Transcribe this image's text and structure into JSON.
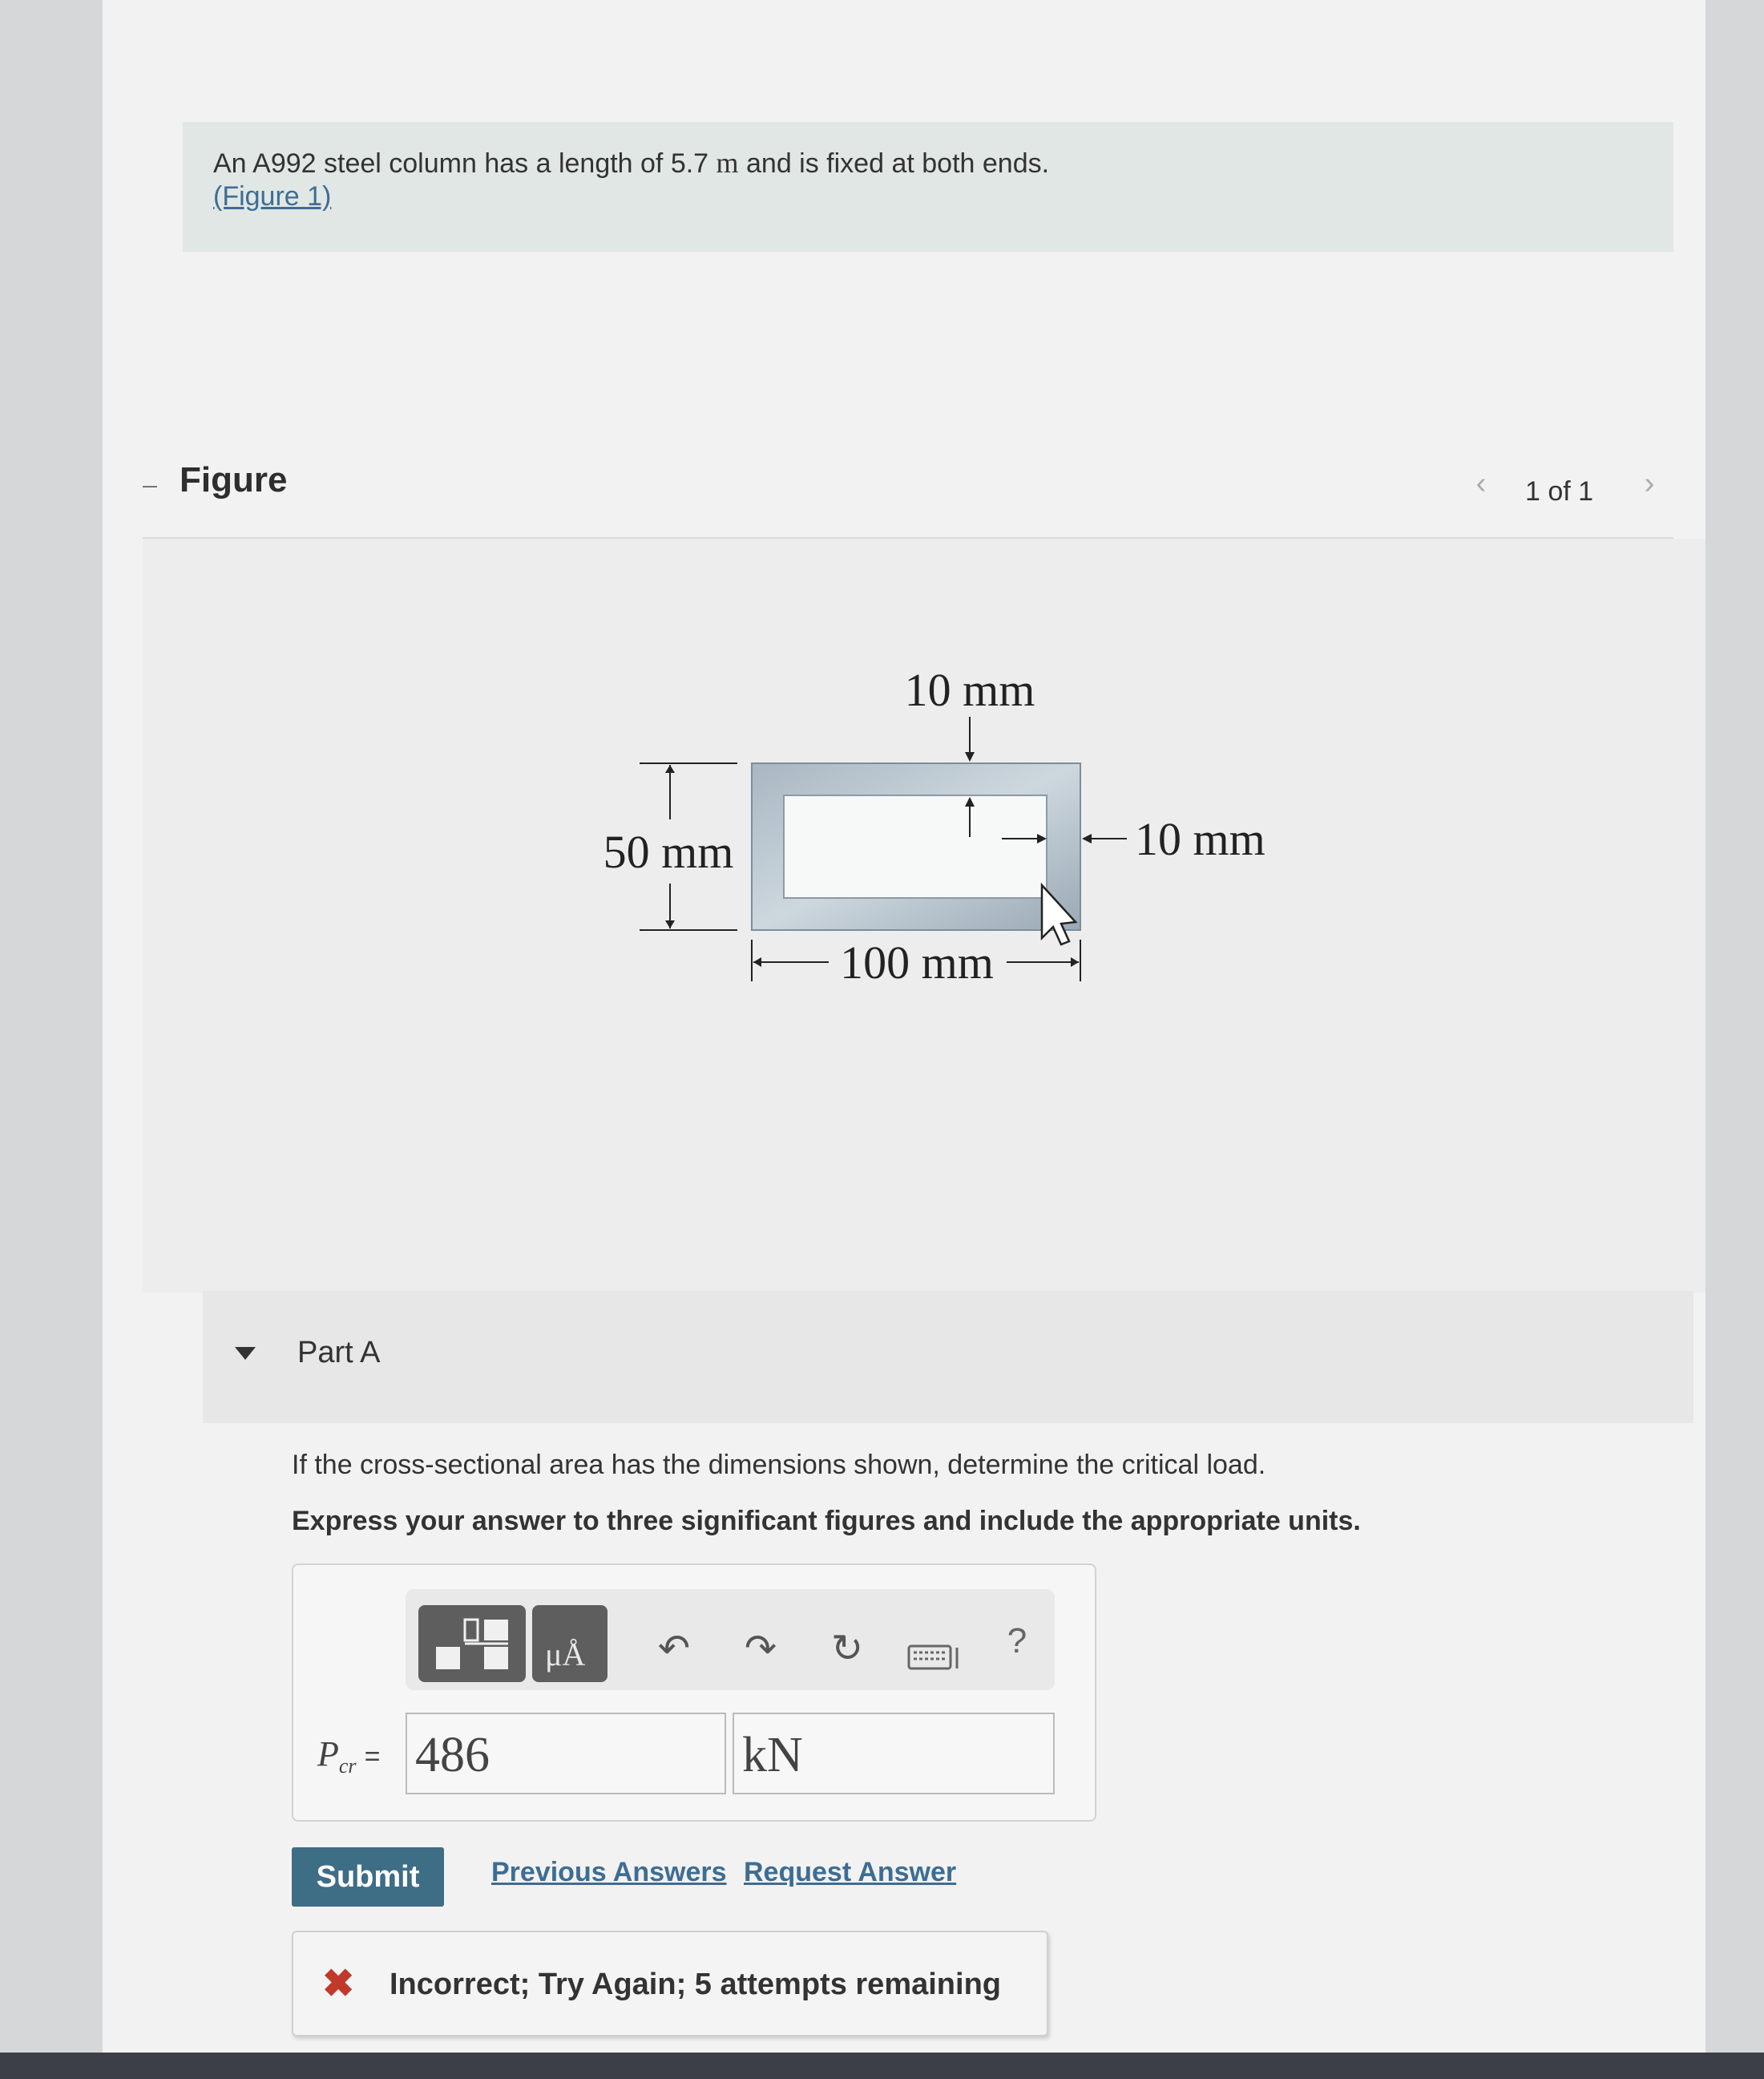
{
  "problem": {
    "text_before_unit": "An A992 steel column has a length of 5.7 ",
    "unit": "m",
    "text_after_unit": " and is fixed at both ends.",
    "figure_link": "(Figure 1)"
  },
  "figure": {
    "title": "Figure",
    "pager": "1 of 1",
    "labels": {
      "top_thickness": "10 mm",
      "height": "50 mm",
      "side_thickness": "10 mm",
      "width": "100 mm"
    }
  },
  "part": {
    "title": "Part A",
    "question": "If the cross-sectional area has the dimensions shown, determine the critical load.",
    "instruction": "Express your answer to three significant figures and include the appropriate units."
  },
  "toolbar": {
    "help": "?",
    "units_glyph": "μÅ"
  },
  "answer": {
    "label_main": "P",
    "label_sub": "cr",
    "equals": "=",
    "value": "486",
    "units": "kN"
  },
  "actions": {
    "submit": "Submit",
    "previous_answers": "Previous Answers",
    "request_answer": "Request Answer"
  },
  "feedback": {
    "icon": "✖",
    "message": "Incorrect; Try Again; 5 attempts remaining"
  }
}
